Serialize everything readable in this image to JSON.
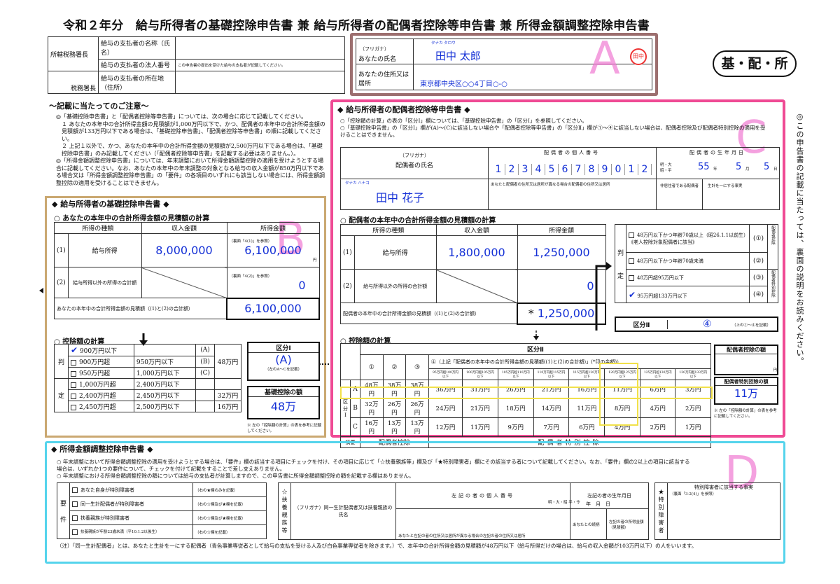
{
  "title": "令和２年分　給与所得者の基礎控除申告書 兼 給与所得者の配偶者控除等申告書 兼 所得金額調整控除申告書",
  "badge": "基・配・所",
  "header": {
    "office_label": "所轄税務署長",
    "office_suffix": "税務署長",
    "payer_name_label": "給与の支払者の名称（氏名）",
    "payer_number_label": "給与の支払者の法人番号",
    "payer_number_note": "この申告書の提出を受けた給与の支払者が記載してください。",
    "payer_address_label": "給与の支払者の所在地（住所）",
    "furigana_label": "（フリガナ）",
    "name_label": "あなたの氏名",
    "furigana_value": "タナカ タロウ",
    "name_value": "田中 太郎",
    "seal": "田中",
    "address_label": "あなたの住所又は居所",
    "address_value": "東京都中央区○○4丁目○-○"
  },
  "letters": {
    "a": "A",
    "b": "B",
    "c": "C",
    "d": "D"
  },
  "notes": {
    "title": "～記載に当たってのご注意～",
    "items": [
      "◎「基礎控除申告書」と「配偶者控除等申告書」については、次の場合に応じて記載してください。",
      "１ あなたの本年中の合計所得金額の見積額が1,000万円以下で、かつ、配偶者の本年中の合計所得金額の見積額が133万円以下である場合は、「基礎控除申告書」、「配偶者控除等申告書」の順に記載してください。",
      "２ 上記１以外で、かつ、あなたの本年中の合計所得金額の見積額が2,500万円以下である場合は、「基礎控除申告書」のみ記載してください（「配偶者控除等申告書」を記載する必要はありません。）。",
      "◎「所得金額調整控除申告書」については、年末調整において所得金額調整控除の適用を受けようとする場合に記載してください。なお、あなたの本年中の年末調整の対象となる給与の収入金額が850万円以下である場合又は「所得金額調整控除申告書」の「要件」の各項目のいずれにも該当しない場合には、所得金額調整控除の適用を受けることはできません。"
    ]
  },
  "side_note": "◎この申告書の記載に当たっては、裏面の説明をお読みください。",
  "basic": {
    "title": "◆ 給与所得者の基礎控除申告書 ◆",
    "calc_title": "○ あなたの本年中の合計所得金額の見積額の計算",
    "headers": [
      "所得の種類",
      "収入金額",
      "所得金額"
    ],
    "row1_label": "給与所得",
    "row1_income": "8,000,000",
    "row1_amount": "6,100,000",
    "row1_ref": "（裏面「4(1)」を参照）",
    "row2_label": "給与所得以外の所得の合計額",
    "row2_amount": "0",
    "row2_ref": "（裏面「4(2)」を参照）",
    "total_label": "あなたの本年中の合計所得金額の見積額（(1)と(2)の合計額）",
    "total_value": "6,100,000",
    "yen": "円",
    "deduct_title": "○ 控除額の計算",
    "options": [
      {
        "a": "900万円以下",
        "b": "",
        "code": "(A)",
        "checked": true
      },
      {
        "a": "900万円超",
        "b": "950万円以下",
        "code": "(B)",
        "checked": false
      },
      {
        "a": "950万円超",
        "b": "1,000万円以下",
        "code": "(C)",
        "checked": false
      },
      {
        "a": "1,000万円超",
        "b": "2,400万円以下",
        "code": "",
        "checked": false
      },
      {
        "a": "2,400万円超",
        "b": "2,450万円以下",
        "code": "",
        "checked": false
      },
      {
        "a": "2,450万円超",
        "b": "2,500万円以下",
        "code": "",
        "checked": false
      }
    ],
    "amounts": [
      "48万円",
      "32万円",
      "16万円"
    ],
    "kubun_label": "区分Ⅰ",
    "kubun_value": "(A)",
    "kubun_note": "（左のA～Cを記載）",
    "deduction_label": "基礎控除の額",
    "deduction_value": "48万",
    "footnote": "※ 左の「控除額の計算」の表を参考に記載してください。",
    "judge": "判",
    "judge2": "定"
  },
  "spouse": {
    "title": "◆ 給与所得者の配偶者控除等申告書 ◆",
    "note1": "○「控除額の計算」の表の「区分Ⅰ」欄については、「基礎控除申告書」の「区分Ⅰ」を参照してください。",
    "note2": "○「基礎控除申告書」の「区分Ⅰ」欄が(A)～(C)に該当しない場合や「配偶者控除等申告書」の「区分Ⅱ」欄が①～④に該当しない場合は、配偶者控除及び配偶者特別控除の適用を受けることはできません。",
    "furigana_label": "（フリガナ）",
    "name_label": "配偶者の氏名",
    "furigana_value": "タナカ ハナコ",
    "name_value": "田中 花子",
    "number_label": "配偶者の個人番号",
    "number_digits": [
      "1",
      "2",
      "3",
      "4",
      "5",
      "6",
      "7",
      "8",
      "9",
      "0",
      "1",
      "2"
    ],
    "birth_label": "配偶者の生年月日",
    "era": "明・大 昭・平",
    "birth_year": "55",
    "birth_month": "5",
    "birth_day": "5",
    "addr_label": "あなたと配偶者の住所又は居所が異なる場合の配偶者の住所又は居所",
    "nonresident_label": "非居住者である配偶者",
    "same_life_label": "生計を一にする事実",
    "calc_title": "○ 配偶者の本年中の合計所得金額の見積額の計算",
    "headers": [
      "所得の種類",
      "収入金額",
      "所得金額"
    ],
    "row1_label": "給与所得",
    "row1_income": "1,800,000",
    "row1_amount": "1,250,000",
    "row2_label": "給与所得以外の所得の合計額",
    "row2_amount": "0",
    "total_label": "配偶者の本年中の合計所得金額の見積額（(1)と(2)の合計額）",
    "total_value": "1,250,000",
    "judge_opts": [
      {
        "label": "48万円以下かつ年齢70歳以上（昭26.1.1以前生）《老人控除対象配偶者に該当》",
        "code": "(①)",
        "checked": false
      },
      {
        "label": "48万円以下かつ年齢70歳未満",
        "code": "(②)",
        "checked": false
      },
      {
        "label": "48万円超95万円以下",
        "code": "(③)",
        "checked": false
      },
      {
        "label": "95万円超133万円以下",
        "code": "(④)",
        "checked": true
      }
    ],
    "side_a": "配偶者控除",
    "side_b": "配偶者特別控除",
    "kubun2_label": "区分Ⅱ",
    "kubun2_value": "④",
    "kubun2_note": "（上の①～④を記載）",
    "deduct_title": "○ 控除額の計算",
    "table_head": "区分Ⅱ",
    "col_titles": [
      "①",
      "②",
      "③"
    ],
    "col4_title": "④（上記「配偶者の本年中の合計所得金額の見積額((1)と(2)の合計額)」(*印の金額)）",
    "ranges": [
      "95万円超100万円以下",
      "100万円超105万円以下",
      "105万円超110万円以下",
      "110万円超115万円以下",
      "115万円超120万円以下",
      "120万円超125万円以下",
      "125万円超130万円以下",
      "130万円超133万円以下"
    ],
    "rows": [
      {
        "k": "A",
        "v": [
          "48万円",
          "38万円",
          "38万円",
          "36万円",
          "31万円",
          "26万円",
          "21万円",
          "16万円",
          "11万円",
          "6万円",
          "3万円"
        ]
      },
      {
        "k": "B",
        "v": [
          "32万円",
          "26万円",
          "26万円",
          "24万円",
          "21万円",
          "18万円",
          "14万円",
          "11万円",
          "8万円",
          "4万円",
          "2万円"
        ]
      },
      {
        "k": "C",
        "v": [
          "16万円",
          "13万円",
          "13万円",
          "12万円",
          "11万円",
          "9万円",
          "7万円",
          "6万円",
          "4万円",
          "2万円",
          "1万円"
        ]
      }
    ],
    "summary": "摘要",
    "sum_a": "配偶者控除",
    "sum_b": "配偶者特別控除",
    "kubun1_side": "区分Ⅰ",
    "deduct_label": "配偶者控除の額",
    "special_label": "配偶者特別控除の額",
    "special_value": "11万",
    "footnote": "※ 左の「控除額の計算」の表を参考に記載してください。"
  },
  "adjust": {
    "title": "◆ 所得金額調整控除申告書 ◆",
    "note1": "○ 年末調整において所得金額調整控除の適用を受けようとする場合は、「要件」欄の該当する項目にチェックを付け、その項目に応じて「☆扶養親族等」欄及び「★特別障害者」欄にその該当する者について記載してください。なお、「要件」欄の2以上の項目に該当する場合は、いずれか1つの要件について、チェックを付けて記載をすることで差し支えありません。",
    "note2": "○ 年末調整における所得金額調整控除の額については給与の支払者が計算しますので、この申告書に所得金額調整控除の額を記載する欄はありません。",
    "req_label": "要件",
    "reqs": [
      {
        "a": "あなた自身が特別障害者",
        "b": "（右の★欄のみを記載）"
      },
      {
        "a": "同一生計配偶者が特別障害者",
        "b": "（右の☆欄及び★欄を記載）"
      },
      {
        "a": "扶養親族が特別障害者",
        "b": "（右の☆欄及び★欄を記載）"
      },
      {
        "a": "扶養親族が年齢23歳未満（平10.1.2以後生）",
        "b": "（右の☆欄を記載）"
      }
    ],
    "dep_label": "☆扶養親族等",
    "dep_name": "（フリガナ）同一生計配偶者又は扶養親族の氏名",
    "dep_number": "左記の者の個人番号",
    "dep_birth": "左記の者の生年月日",
    "dep_era": "明・大・昭 平・令",
    "dep_date": "年　月　日",
    "dep_addr": "あなたと左記の者の住所又は居所が異なる場合の左記の者の住所又は居所",
    "dep_rel": "あなたとの続柄",
    "dep_income": "左記の者の所得金額（見積額）",
    "sp_label": "★特別障害者",
    "sp_title": "特別障害者に該当する事実",
    "sp_ref": "（裏面「3-2(4)」を参照）",
    "footnote": "（注）「同一生計配偶者」とは、あなたと生計を一にする配偶者（青色事業専従者として給与の支払を受ける人及び白色事業専従者を除きます。）で、本年中の合計所得金額の見積額が48万円以下（給与所得だけの場合は、給与の収入金額が103万円以下）の人をいいます。"
  }
}
